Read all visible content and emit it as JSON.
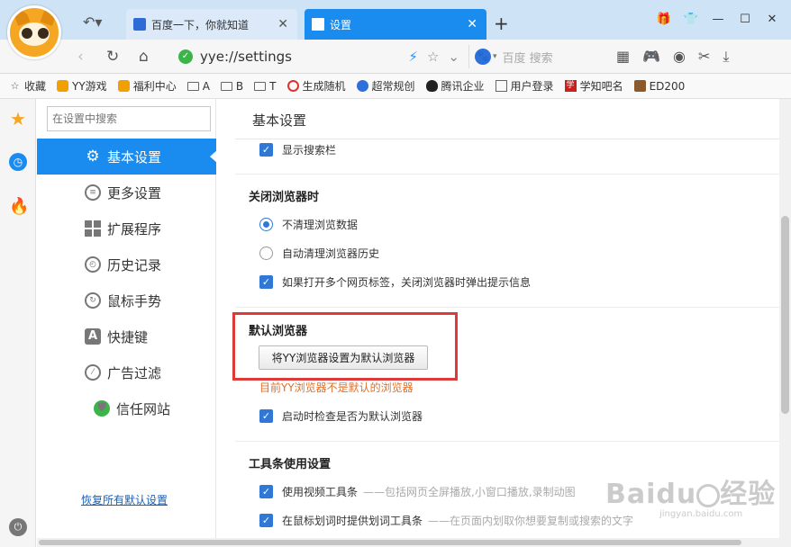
{
  "tabs": [
    {
      "label": "百度一下，你就知道",
      "active": false
    },
    {
      "label": "设置",
      "active": true
    }
  ],
  "address": {
    "url": "yye://settings",
    "search_placeholder": "百度 搜索"
  },
  "bookmarks": [
    {
      "label": "收藏",
      "icon": "star-icon"
    },
    {
      "label": "YY游戏",
      "icon": "tiger-icon"
    },
    {
      "label": "福利中心",
      "icon": "tiger-icon"
    },
    {
      "label": "A",
      "icon": "folder-icon"
    },
    {
      "label": "B",
      "icon": "folder-icon"
    },
    {
      "label": "T",
      "icon": "folder-icon"
    },
    {
      "label": "生成随机",
      "icon": "target-icon"
    },
    {
      "label": "超常规创",
      "icon": "paw-icon"
    },
    {
      "label": "腾讯企业",
      "icon": "penguin-icon"
    },
    {
      "label": "用户登录",
      "icon": "document-icon"
    },
    {
      "label": "学知吧名",
      "icon": "xue-icon"
    },
    {
      "label": "ED200",
      "icon": "game-icon"
    }
  ],
  "sidebar": {
    "search_placeholder": "在设置中搜索",
    "items": [
      {
        "label": "基本设置",
        "icon": "gear-icon"
      },
      {
        "label": "更多设置",
        "icon": "list-icon"
      },
      {
        "label": "扩展程序",
        "icon": "grid-icon"
      },
      {
        "label": "历史记录",
        "icon": "clock-icon"
      },
      {
        "label": "鼠标手势",
        "icon": "gesture-icon"
      },
      {
        "label": "快捷键",
        "icon": "a-key-icon"
      },
      {
        "label": "广告过滤",
        "icon": "block-icon"
      },
      {
        "label": "信任网站",
        "icon": "shield-icon"
      }
    ],
    "active_index": 0,
    "restore_link": "恢复所有默认设置"
  },
  "content": {
    "page_title": "基本设置",
    "show_search_bar": "显示搜索栏",
    "close_section": {
      "heading": "关闭浏览器时",
      "options": [
        {
          "label": "不清理浏览数据",
          "checked": true
        },
        {
          "label": "自动清理浏览器历史",
          "checked": false
        }
      ],
      "prompt_multiple_tabs": "如果打开多个网页标签，关闭浏览器时弹出提示信息"
    },
    "default_section": {
      "heading": "默认浏览器",
      "button": "将YY浏览器设置为默认浏览器",
      "warning": "目前YY浏览器不是默认的浏览器",
      "check_on_startup": "启动时检查是否为默认浏览器"
    },
    "toolbar_section": {
      "heading": "工具条使用设置",
      "items": [
        {
          "label": "使用视频工具条",
          "hint": "——包括网页全屏播放,小窗口播放,录制动图"
        },
        {
          "label": "在鼠标划词时提供划词工具条",
          "hint": "——在页面内划取你想要复制或搜索的文字"
        }
      ]
    }
  },
  "watermark": {
    "brand": "Baidu",
    "suffix": "经验",
    "sub": "jingyan.baidu.com"
  },
  "colors": {
    "accent": "#1a8cf0",
    "highlight_box": "#dd3a3a",
    "warning": "#e0702a"
  }
}
